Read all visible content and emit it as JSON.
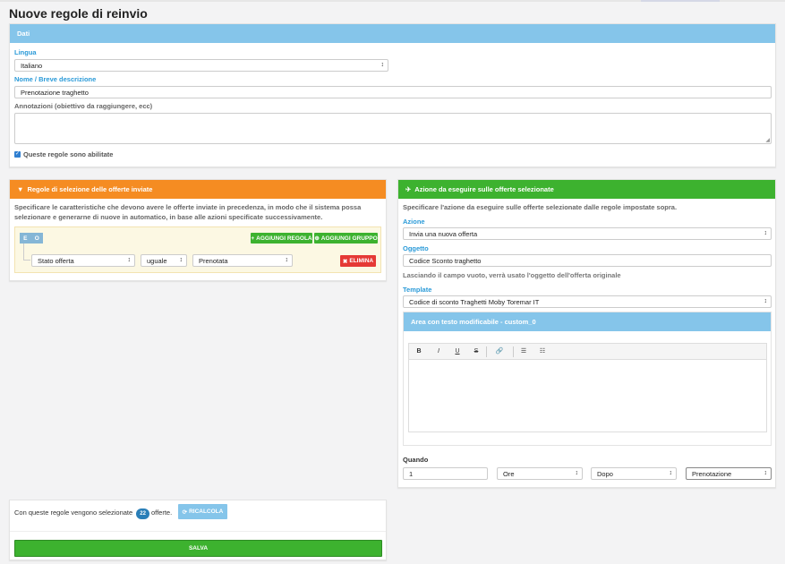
{
  "page": {
    "title": "Nuove regole di reinvio"
  },
  "dati": {
    "header": "Dati",
    "lingua_label": "Lingua",
    "lingua_value": "Italiano",
    "nome_label": "Nome / Breve descrizione",
    "nome_value": "Prenotazione traghetto",
    "annotazioni_label": "Annotazioni (obiettivo da raggiungere, ecc)",
    "annotazioni_value": "",
    "enabled_label": "Queste regole sono abilitate",
    "enabled_checked": true
  },
  "regole": {
    "header": "Regole di selezione delle offerte inviate",
    "description": "Specificare le caratteristiche che devono avere le offerte inviate in precedenza, in modo che il sistema possa selezionare e generarne di nuove in automatico, in base alle azioni specificate successivamente.",
    "and_label": "E",
    "or_label": "O",
    "add_rule_label": "AGGIUNGI REGOLA",
    "add_group_label": "AGGIUNGI GRUPPO",
    "rule": {
      "field": "Stato offerta",
      "operator": "uguale",
      "value": "Prenotata",
      "delete_label": "ELIMINA"
    }
  },
  "azione": {
    "header": "Azione da eseguire sulle offerte selezionate",
    "description": "Specificare l'azione da eseguire sulle offerte selezionate dalle regole impostate sopra.",
    "azione_label": "Azione",
    "azione_value": "Invia una nuova offerta",
    "oggetto_label": "Oggetto",
    "oggetto_value": "Codice Sconto traghetto",
    "oggetto_hint": "Lasciando il campo vuoto, verrà usato l'oggetto dell'offerta originale",
    "template_label": "Template",
    "template_value": "Codice di sconto Traghetti Moby Toremar IT",
    "editor_header": "Area con testo modificabile - custom_0",
    "toolbar": {
      "bold": "B",
      "italic": "I",
      "underline": "U",
      "strike": "S",
      "link": "🔗",
      "ul": "☰",
      "ol": "☷"
    },
    "quando_label": "Quando",
    "quando_value": "1",
    "unit_value": "Ore",
    "relation_value": "Dopo",
    "event_value": "Prenotazione"
  },
  "summary": {
    "prefix": "Con queste regole vengono selezionate",
    "count": "22",
    "suffix": "offerte.",
    "recalc_label": "RICALCOLA",
    "save_label": "SALVA"
  },
  "colors": {
    "blue_header": "#85c5ea",
    "orange_header": "#f58c22",
    "green_header": "#3db22f",
    "danger": "#e53935",
    "label_blue": "#2a9ad8"
  }
}
